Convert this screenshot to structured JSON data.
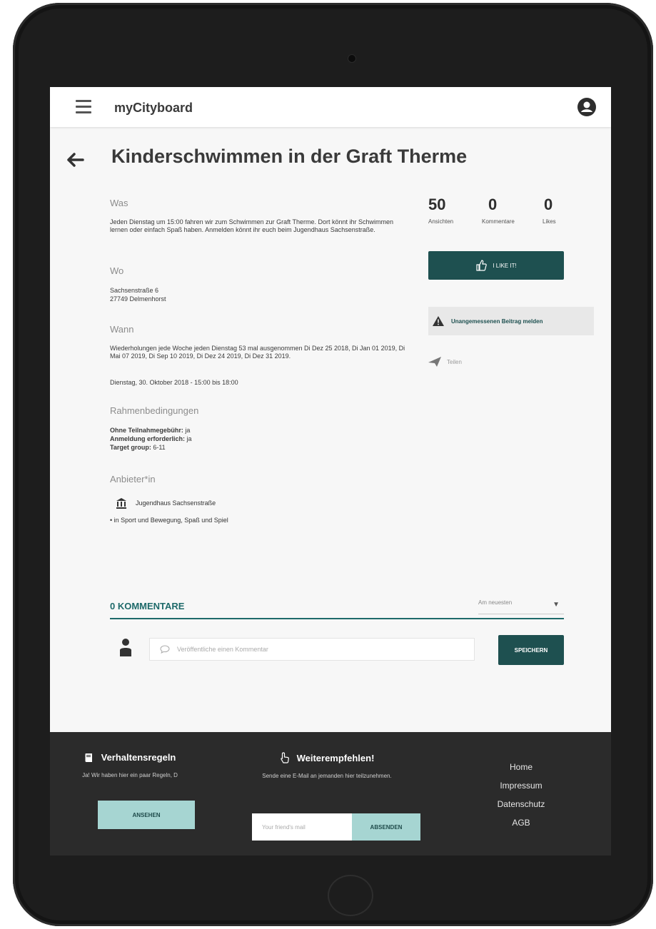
{
  "header": {
    "brand": "myCityboard"
  },
  "page": {
    "title": "Kinderschwimmen in der Graft Therme"
  },
  "details": {
    "was_heading": "Was",
    "was_text": "Jeden Dienstag um 15:00 fahren wir zum Schwimmen zur Graft Therme. Dort könnt ihr Schwimmen lernen oder einfach Spaß haben. Anmelden könnt ihr euch beim Jugendhaus Sachsenstraße.",
    "wo_heading": "Wo",
    "wo_line1": "Sachsenstraße 6",
    "wo_line2": "27749 Delmenhorst",
    "wann_heading": "Wann",
    "wann_text": "Wiederholungen jede Woche jeden Dienstag 53 mal ausgenommen Di Dez 25 2018, Di Jan 01 2019, Di Mai 07 2019, Di Sep 10 2019, Di Dez 24 2019, Di Dez 31 2019.",
    "wann_time": "Dienstag, 30. Oktober 2018 - 15:00 bis 18:00",
    "rahmen_heading": "Rahmenbedingungen",
    "cond1_label": "Ohne Teilnahmegebühr:",
    "cond1_value": "ja",
    "cond2_label": "Anmeldung erforderlich:",
    "cond2_value": "ja",
    "cond3_label": "Target group:",
    "cond3_value": "6-11",
    "anbieter_heading": "Anbieter*in",
    "provider_name": "Jugendhaus Sachsenstraße",
    "category": "in Sport und Bewegung, Spaß und Spiel"
  },
  "stats": {
    "views": "50",
    "views_label": "Ansichten",
    "comments": "0",
    "comments_label": "Kommentare",
    "likes": "0",
    "likes_label": "Likes"
  },
  "actions": {
    "like_label": "I LIKE IT!",
    "report_label": "Unangemessenen Beitrag melden",
    "share_label": "Teilen"
  },
  "comments": {
    "title": "0 KOMMENTARE",
    "sort_value": "Am neuesten",
    "input_placeholder": "Veröffentliche einen Kommentar",
    "save_label": "SPEICHERN"
  },
  "footer": {
    "rules_title": "Verhaltensregeln",
    "rules_text": "Ja! Wir haben hier ein paar Regeln, D",
    "rules_button": "ANSEHEN",
    "recommend_title": "Weiterempfehlen!",
    "recommend_text": "Sende eine E-Mail an jemanden hier teilzunehmen.",
    "email_placeholder": "Your friend's mail",
    "send_button": "ABSENDEN",
    "links": [
      "Home",
      "Impressum",
      "Datenschutz",
      "AGB"
    ]
  },
  "colors": {
    "accent": "#1e5050",
    "accent_light": "#a6d5d2",
    "footer_bg": "#2b2b2b"
  }
}
